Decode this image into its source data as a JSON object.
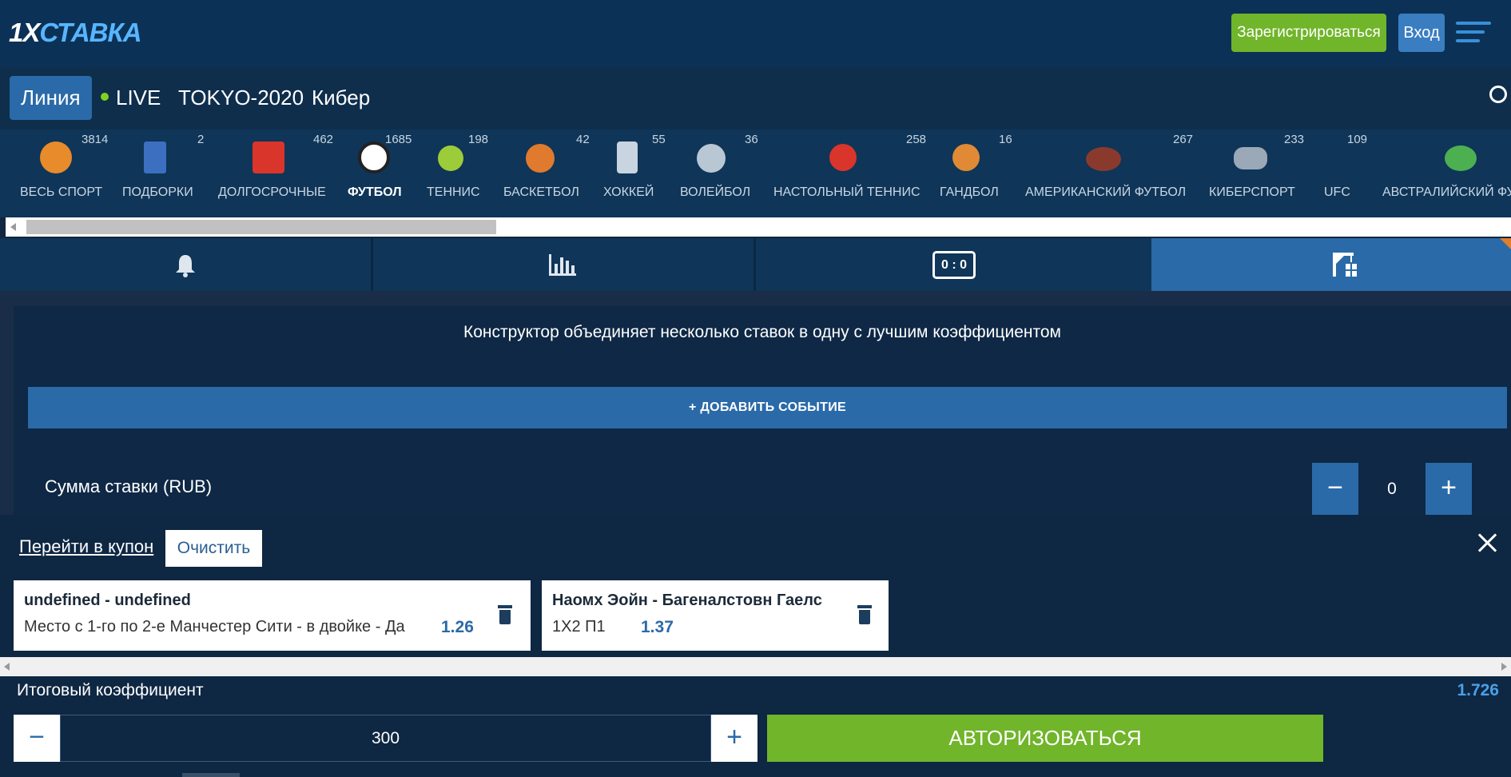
{
  "header": {
    "logo_a": "1X",
    "logo_b": "СТАВКА",
    "register_label": "Зарегистрироваться",
    "login_label": "Вход"
  },
  "nav": {
    "tabs": [
      {
        "label": "Линия"
      },
      {
        "label": "LIVE"
      },
      {
        "label": "TOKYO-2020"
      },
      {
        "label": "Кибер"
      }
    ]
  },
  "sports": [
    {
      "label": "ВЕСЬ СПОРТ",
      "count": "3814",
      "icon": "all-sports-icon",
      "color": "#e88b2a"
    },
    {
      "label": "ПОДБОРКИ",
      "count": "2",
      "icon": "star-flag-icon",
      "color": "#3c6fbf"
    },
    {
      "label": "ДОЛГОСРОЧНЫЕ",
      "count": "462",
      "icon": "bars-icon",
      "color": "#d9352b"
    },
    {
      "label": "ФУТБОЛ",
      "count": "1685",
      "icon": "soccer-ball-icon",
      "color": "#ffffff"
    },
    {
      "label": "ТЕННИС",
      "count": "198",
      "icon": "tennis-ball-icon",
      "color": "#9ccc3a"
    },
    {
      "label": "БАСКЕТБОЛ",
      "count": "42",
      "icon": "basketball-icon",
      "color": "#e07a2e"
    },
    {
      "label": "ХОККЕЙ",
      "count": "55",
      "icon": "skate-icon",
      "color": "#c8d4e0"
    },
    {
      "label": "ВОЛЕЙБОЛ",
      "count": "36",
      "icon": "volleyball-icon",
      "color": "#b9c6d4"
    },
    {
      "label": "НАСТОЛЬНЫЙ ТЕННИС",
      "count": "258",
      "icon": "ping-pong-icon",
      "color": "#d9352b"
    },
    {
      "label": "ГАНДБОЛ",
      "count": "16",
      "icon": "handball-icon",
      "color": "#e08a36"
    },
    {
      "label": "АМЕРИКАНСКИЙ ФУТБОЛ",
      "count": "267",
      "icon": "american-football-icon",
      "color": "#8a3a2c"
    },
    {
      "label": "КИБЕРСПОРТ",
      "count": "233",
      "icon": "gamepad-icon",
      "color": "#9aa8b8"
    },
    {
      "label": "UFC",
      "count": "109",
      "icon": "ufc-icon",
      "color": "#d9352b"
    },
    {
      "label": "АВСТРАЛИЙСКИЙ ФУ",
      "count": "",
      "icon": "aussie-rules-icon",
      "color": "#4caf50"
    }
  ],
  "tools": {
    "score_label": "0 : 0"
  },
  "constructor": {
    "info": "Конструктор объединяет несколько ставок в одну с лучшим коэффициентом",
    "add_event": "+  ДОБАВИТЬ СОБЫТИЕ",
    "sum_label": "Сумма ставки (RUB)",
    "sum_value": "0",
    "minus": "−",
    "plus": "+"
  },
  "coupon": {
    "to_coupon": "Перейти в купон",
    "clear": "Очистить",
    "bets": [
      {
        "title": "undefined - undefined",
        "desc": "Место с 1-го по 2-е Манчестер Сити - в двойке - Да",
        "odd": "1.26"
      },
      {
        "title": "Наомх Эойн - Багеналстовн Гаелс",
        "desc": "1Х2 П1",
        "odd": "1.37"
      }
    ],
    "total_label": "Итоговый коэффициент",
    "total_value": "1.726",
    "stake": "300",
    "minus": "−",
    "plus": "+",
    "auth": "АВТОРИЗОВАТЬСЯ"
  },
  "colors": {
    "accent": "#2a6aa8",
    "green": "#70b52a",
    "header_bg": "#0b3256"
  }
}
